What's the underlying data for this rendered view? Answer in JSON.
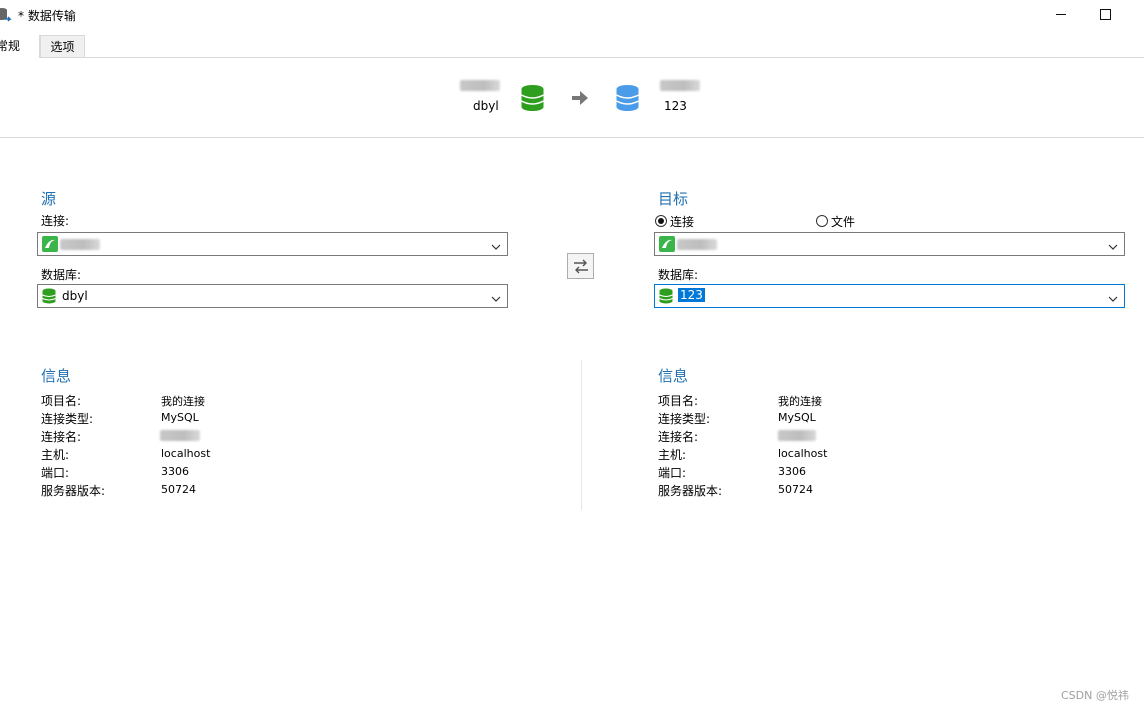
{
  "window": {
    "title": "* 数据传输",
    "icon": "data-transfer-icon",
    "controls": [
      "minimize",
      "maximize"
    ]
  },
  "tabs": [
    {
      "label": "常规",
      "active": true
    },
    {
      "label": "选项",
      "active": false
    }
  ],
  "summary": {
    "source_db": "dbyl",
    "target_db": "123",
    "arrow_icon": "arrow-right-icon"
  },
  "source": {
    "heading": "源",
    "connection_label": "连接:",
    "database_label": "数据库:",
    "database_value": "dbyl"
  },
  "target": {
    "heading": "目标",
    "radio_connection": "连接",
    "radio_file": "文件",
    "selected_mode": "connection",
    "database_label": "数据库:",
    "database_value": "123"
  },
  "source_info": {
    "heading": "信息",
    "rows": [
      {
        "key": "项目名:",
        "value": "我的连接"
      },
      {
        "key": "连接类型:",
        "value": "MySQL"
      },
      {
        "key": "连接名:",
        "value": ""
      },
      {
        "key": "主机:",
        "value": "localhost"
      },
      {
        "key": "端口:",
        "value": "3306"
      },
      {
        "key": "服务器版本:",
        "value": "50724"
      }
    ]
  },
  "target_info": {
    "heading": "信息",
    "rows": [
      {
        "key": "项目名:",
        "value": "我的连接"
      },
      {
        "key": "连接类型:",
        "value": "MySQL"
      },
      {
        "key": "连接名:",
        "value": ""
      },
      {
        "key": "主机:",
        "value": "localhost"
      },
      {
        "key": "端口:",
        "value": "3306"
      },
      {
        "key": "服务器版本:",
        "value": "50724"
      }
    ]
  },
  "watermark": "CSDN @悦祎",
  "colors": {
    "source_db": "#2e9e1f",
    "target_db": "#4a9be8",
    "heading": "#1f6fb2",
    "focus": "#0078d7"
  }
}
